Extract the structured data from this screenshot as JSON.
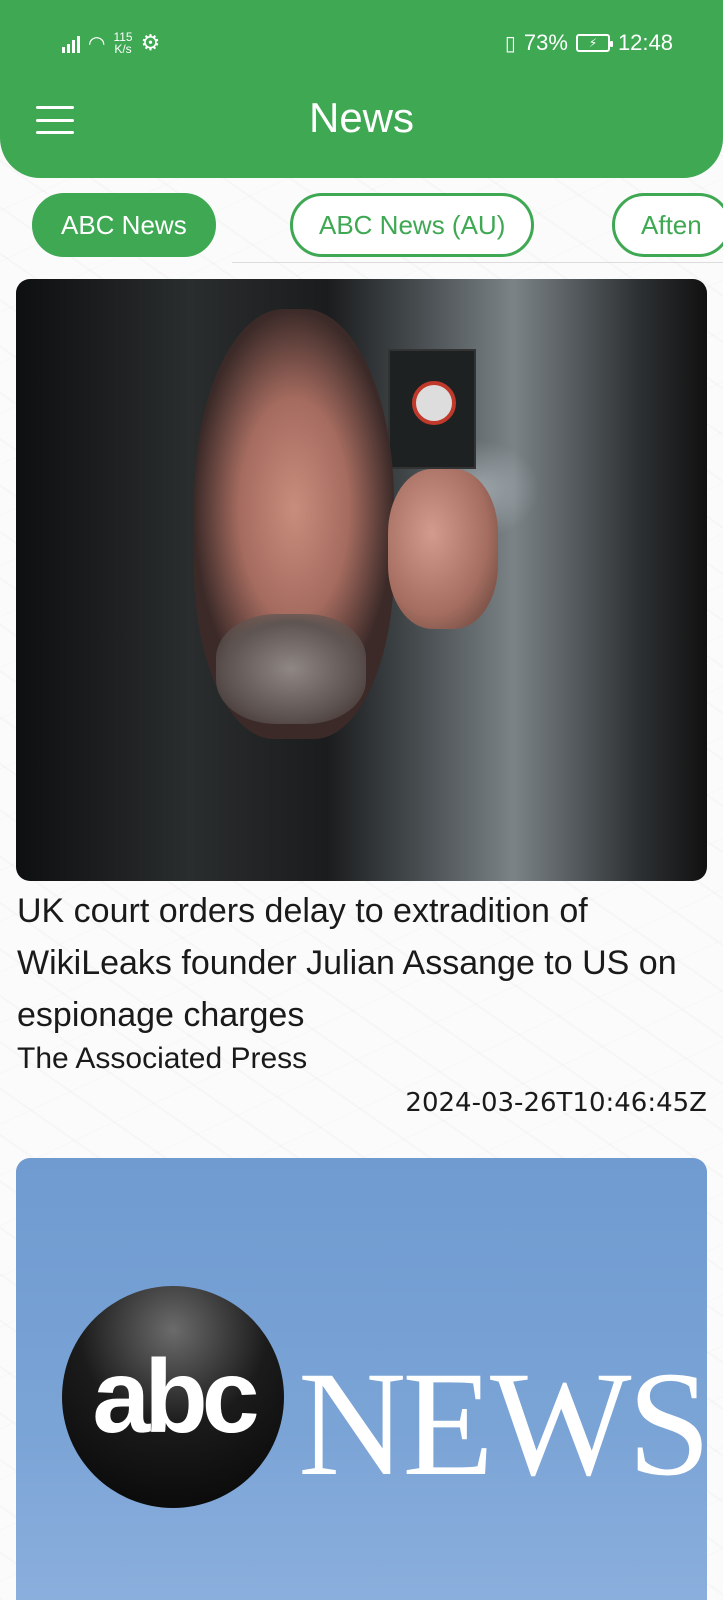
{
  "status_bar": {
    "net_speed_value": "115",
    "net_speed_unit": "K/s",
    "battery_percent": "73%",
    "time": "12:48"
  },
  "app_bar": {
    "title": "News",
    "menu_icon": "hamburger-menu-icon",
    "background_color": "#3ea853"
  },
  "tabs": [
    {
      "label": "ABC News",
      "active": true
    },
    {
      "label": "ABC News (AU)",
      "active": false
    },
    {
      "label": "Aften",
      "active": false
    }
  ],
  "articles": [
    {
      "image_description": "photo",
      "headline": "UK court orders delay to extradition of WikiLeaks founder Julian Assange to US on espionage charges",
      "source": "The Associated Press",
      "published": "2024-03-26T10:46:45Z"
    },
    {
      "image_logo_text_a": "abc",
      "image_logo_text_b": "NEWS"
    }
  ]
}
